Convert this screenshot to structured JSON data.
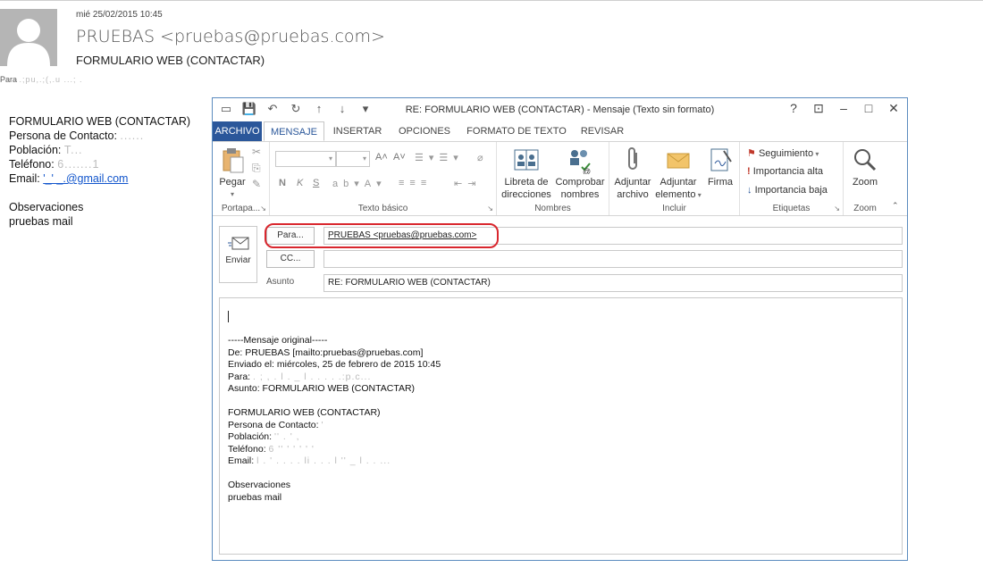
{
  "header": {
    "date": "mié 25/02/2015 10:45",
    "from": "PRUEBAS <pruebas@pruebas.com>",
    "subject": "FORMULARIO WEB (CONTACTAR)",
    "to_label": "Para",
    "to_value": ".;pu,.;(,.u ...; ."
  },
  "bg_body": {
    "line1": "FORMULARIO WEB (CONTACTAR)",
    "line2_label": "Persona de Contacto: ",
    "line2_value": "......",
    "line3_label": "Población: ",
    "line3_value": "T...",
    "line4_label": "Teléfono: ",
    "line4_value": "6.......1",
    "line5_label": "Email: ",
    "line5_value": "'_'                 _.@gmail.com",
    "line7": "Observaciones",
    "line8": "pruebas mail"
  },
  "window": {
    "title": "RE: FORMULARIO WEB (CONTACTAR) - Mensaje (Texto sin formato)",
    "help": "?",
    "restore_ribbon": "⊡",
    "minimize": "–",
    "maximize": "□",
    "close": "✕",
    "qat": {
      "save": "💾",
      "undo": "↶",
      "redo": "↻",
      "up": "↑",
      "down": "↓",
      "more": "▾",
      "mail": "▭"
    }
  },
  "tabs": [
    {
      "label": "ARCHIVO"
    },
    {
      "label": "MENSAJE"
    },
    {
      "label": "INSERTAR"
    },
    {
      "label": "OPCIONES"
    },
    {
      "label": "FORMATO DE TEXTO"
    },
    {
      "label": "REVISAR"
    }
  ],
  "ribbon": {
    "groups": {
      "clipboard": "Portapa...",
      "basic_text": "Texto básico",
      "names": "Nombres",
      "include": "Incluir",
      "tags": "Etiquetas",
      "zoom": "Zoom"
    },
    "paste": "Pegar",
    "bold": "N",
    "italic": "K",
    "underline": "S",
    "grow_font": "A˄",
    "shrink_font": "A˅",
    "address_book_1": "Libreta de",
    "address_book_2": "direcciones",
    "check_names_1": "Comprobar",
    "check_names_2": "nombres",
    "attach_file_1": "Adjuntar",
    "attach_file_2": "archivo",
    "attach_item_1": "Adjuntar",
    "attach_item_2": "elemento",
    "signature": "Firma",
    "follow_up": "Seguimiento",
    "high_importance": "Importancia alta",
    "low_importance": "Importancia baja",
    "zoom": "Zoom"
  },
  "compose": {
    "send": "Enviar",
    "to_button": "Para...",
    "cc_button": "CC...",
    "subject_label": "Asunto",
    "to_value": "PRUEBAS <pruebas@pruebas.com>",
    "cc_value": "",
    "subject_value": "RE: FORMULARIO WEB (CONTACTAR)"
  },
  "body": {
    "l1": "-----Mensaje original-----",
    "l2": "De: PRUEBAS [mailto:pruebas@pruebas.com]",
    "l3": "Enviado el: miércoles, 25 de febrero de 2015 10:45",
    "l4_label": "Para: ",
    "l4_value": "  .  ; , .  l . _ l . .  .  .  .:p.c...",
    "l5": "Asunto: FORMULARIO WEB (CONTACTAR)",
    "l7": "FORMULARIO WEB (CONTACTAR)",
    "l8_label": "Persona de Contacto: ",
    "l8_value": "'",
    "l9_label": "Población: ",
    "l9_value": "'' . ' ,",
    "l10_label": "Teléfono: ",
    "l10_value": "6 '' ' ' ' ' '",
    "l11_label": "Email: ",
    "l11_value": "l . ' . . . . li . . . l '' _ l . .  ...",
    "l13": "Observaciones",
    "l14": "pruebas mail"
  }
}
